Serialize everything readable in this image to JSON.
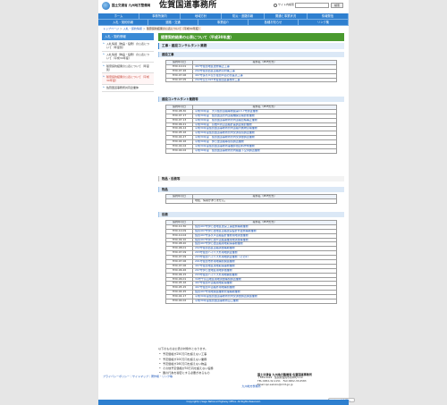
{
  "header": {
    "org_line": "国土交通省 九州地方整備局",
    "site_title": "佐賀国道事務所",
    "search_label": "サイト内検索",
    "search_button": "検索"
  },
  "nav": {
    "row1": [
      "ホーム",
      "事務所案内",
      "地域方針",
      "防災・道路情報",
      "開通と事業状況",
      "情報発信"
    ],
    "row2": [
      "入札・契約情報",
      "道路・交通",
      "事業紹介",
      "各種お知らせ",
      "リンク集"
    ]
  },
  "breadcrumb": [
    "トップページ",
    "入札・契約情報",
    "随意契約結果の公表について（平成30年度）"
  ],
  "sidebar": {
    "heading": "入札・契約情報",
    "items": [
      "入札情報（物品・役務）の公表について（年度別）",
      "入札情報（物品・役務）の公表について（平成30年度）",
      "随意契約結果の公表について（年度別）",
      "随意契約結果の公表について（平成30年度）",
      "佐賀国道事務所共同企業体"
    ]
  },
  "main": {
    "title": "随意契約結果の公表について（平成30年度）",
    "subsection": "工事・建設コンサルタント業務",
    "categories": {
      "kouji": "建設工事",
      "consul": "建設コンサルタント業務等",
      "buppin_yakumu": "物品・役務等",
      "buppin": "物品",
      "yakumu": "役務"
    },
    "table_headers": {
      "date": "契約年月日",
      "name": "案件名（PDF形式）"
    },
    "kouji_rows": [
      {
        "date": "H30.10.01",
        "name": "497号佐賀地区改修補正工事"
      },
      {
        "date": "H30.07.26",
        "name": "202号佐賀西区道路防災対策工事"
      },
      {
        "date": "H30.07.06",
        "name": "497号多久IC及び佐賀IC道の交差点工事"
      },
      {
        "date": "H30.07.05",
        "name": "202号及び497号佐賀国道事務所工事"
      }
    ],
    "consul_rows": [
      {
        "date": "H30.08.30",
        "name": "平成30年度　大川佐賀道路等発掘第13-7号調査業務"
      },
      {
        "date": "H30.07.17",
        "name": "平成30年度　佐賀国道管内道路橋梁点検診断業務"
      },
      {
        "date": "H30.07.13",
        "name": "平成30年度　佐賀国道事務所管内道路台帳補正業務"
      },
      {
        "date": "H30.06.21",
        "name": "平成30年度　鳥栖IC周辺道路計画調査検討業務"
      },
      {
        "date": "H30.06.14",
        "name": "平成30年度佐賀国道事務所管内道路付属物点検業務"
      },
      {
        "date": "H30.05.16",
        "name": "平成30年度佐賀国道事務所管内交通環境調査業務"
      },
      {
        "date": "H30.04.27",
        "name": "平成30年度　佐賀国道事務所管内交通量調査業務"
      },
      {
        "date": "H30.04.16",
        "name": "平成30年度　伊万里道路等環境調査業務"
      },
      {
        "date": "H30.04.04",
        "name": "平成30年度佐賀国道事務所事業評価資料作成業務"
      },
      {
        "date": "H30.04.02",
        "name": "平成30年度　佐賀国道事務所管内路面下空洞調査業務"
      }
    ],
    "buppin_rows": [
      {
        "date": "",
        "name": "現在、情報がありません。",
        "is_note": true
      }
    ],
    "yakumu_rows": [
      {
        "date": "H30.10.30",
        "name": "佐賀497号伊万里地区改良工事監督補助業務"
      },
      {
        "date": "H30.10.09",
        "name": "佐賀497号伊万里地区道路改良設計外監督補助業務"
      },
      {
        "date": "H30.10.04",
        "name": "佐賀497号多久IC道路設計業務用地測量業務"
      },
      {
        "date": "H30.09.10",
        "name": "佐賀497号伊万里IC道路事業用地測量等業務"
      },
      {
        "date": "H30.08.20",
        "name": "佐賀497号伊万里道路用地取得事務業務"
      },
      {
        "date": "H30.08.01",
        "name": "202号佐賀西区道路測量補助業務"
      },
      {
        "date": "H30.07.09",
        "name": "203号佐賀バイパス外用地調査業務"
      },
      {
        "date": "H30.07.09",
        "name": "203号佐賀バイパス外用地調査業務（その2）"
      },
      {
        "date": "H30.07.06",
        "name": "201号佐賀市外用地補償関連業務"
      },
      {
        "date": "H30.07.06",
        "name": "497号佐賀地区用地取得事務業務"
      },
      {
        "date": "H30.06.26",
        "name": "207号伊万里地区用地評価業務"
      },
      {
        "date": "H30.06.15",
        "name": "203号佐賀バイパス外用地補償業務"
      },
      {
        "date": "H30.06.01",
        "name": "34号千鳥山地区用地測量補償調査業務"
      },
      {
        "date": "H30.05.16",
        "name": "497号佐賀IC道路用地取得業務"
      },
      {
        "date": "H30.05.15",
        "name": "497号佐賀IC道路外用地補償業務"
      },
      {
        "date": "H30.04.25",
        "name": "佐賀497号用地関連業務管理補助業務"
      },
      {
        "date": "H30.04.17",
        "name": "平成30年度佐賀国道事務所管内交通量調査関連業務"
      },
      {
        "date": "H30.04.02",
        "name": "平成30年度佐賀国道事務所窓口業務"
      }
    ]
  },
  "notes": {
    "intro": "以下のものは公表の対象外となります。",
    "items": [
      "予定価格が250万円を超えない工事",
      "予定価格が100万円を超えない業務",
      "予定価格が160万円を超えない物品",
      "その他予定価格が50万円を超えない役務",
      "国の行為を秘密にする必要があるもの"
    ],
    "office_name": "九州地方整備局",
    "pagetop": "ページの先頭へ"
  },
  "footer": {
    "links": "プライバシーポリシー｜サイトマップ｜著作権・リンク等",
    "office": "国土交通省 九州地方整備局 佐賀国道事務所",
    "postal": "〒849-0924　佐賀県佐賀市新中町5-10",
    "tel": "TEL:0952-32-1151　FAX:0952-33-0583",
    "email": "Email:qsr-sakuko@mlit.go.jp",
    "copyright": "Copyright(c) Saga National Highway Office. All Rights Reserved."
  }
}
